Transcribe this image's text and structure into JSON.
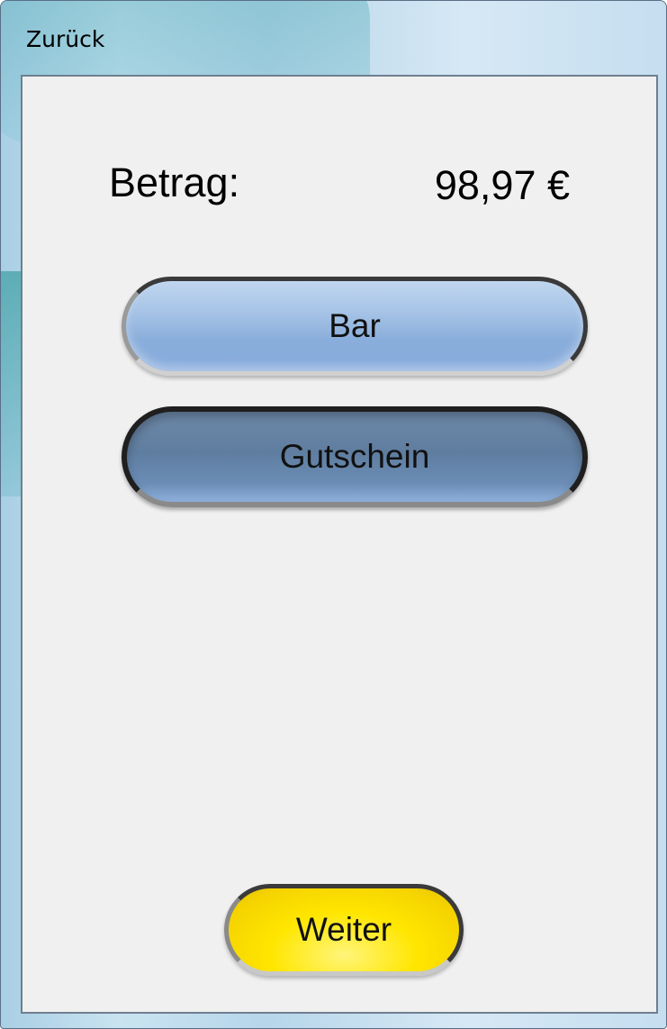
{
  "window": {
    "title": "Zurück"
  },
  "payment": {
    "amount_label": "Betrag:",
    "amount_value": "98,97 €"
  },
  "buttons": {
    "bar": "Bar",
    "gutschein": "Gutschein",
    "weiter": "Weiter"
  },
  "colors": {
    "bar_button": "#a6c3e6",
    "gutschein_button": "#5f7d9f",
    "weiter_button": "#ffe600",
    "client_background": "#f0f0f0"
  }
}
